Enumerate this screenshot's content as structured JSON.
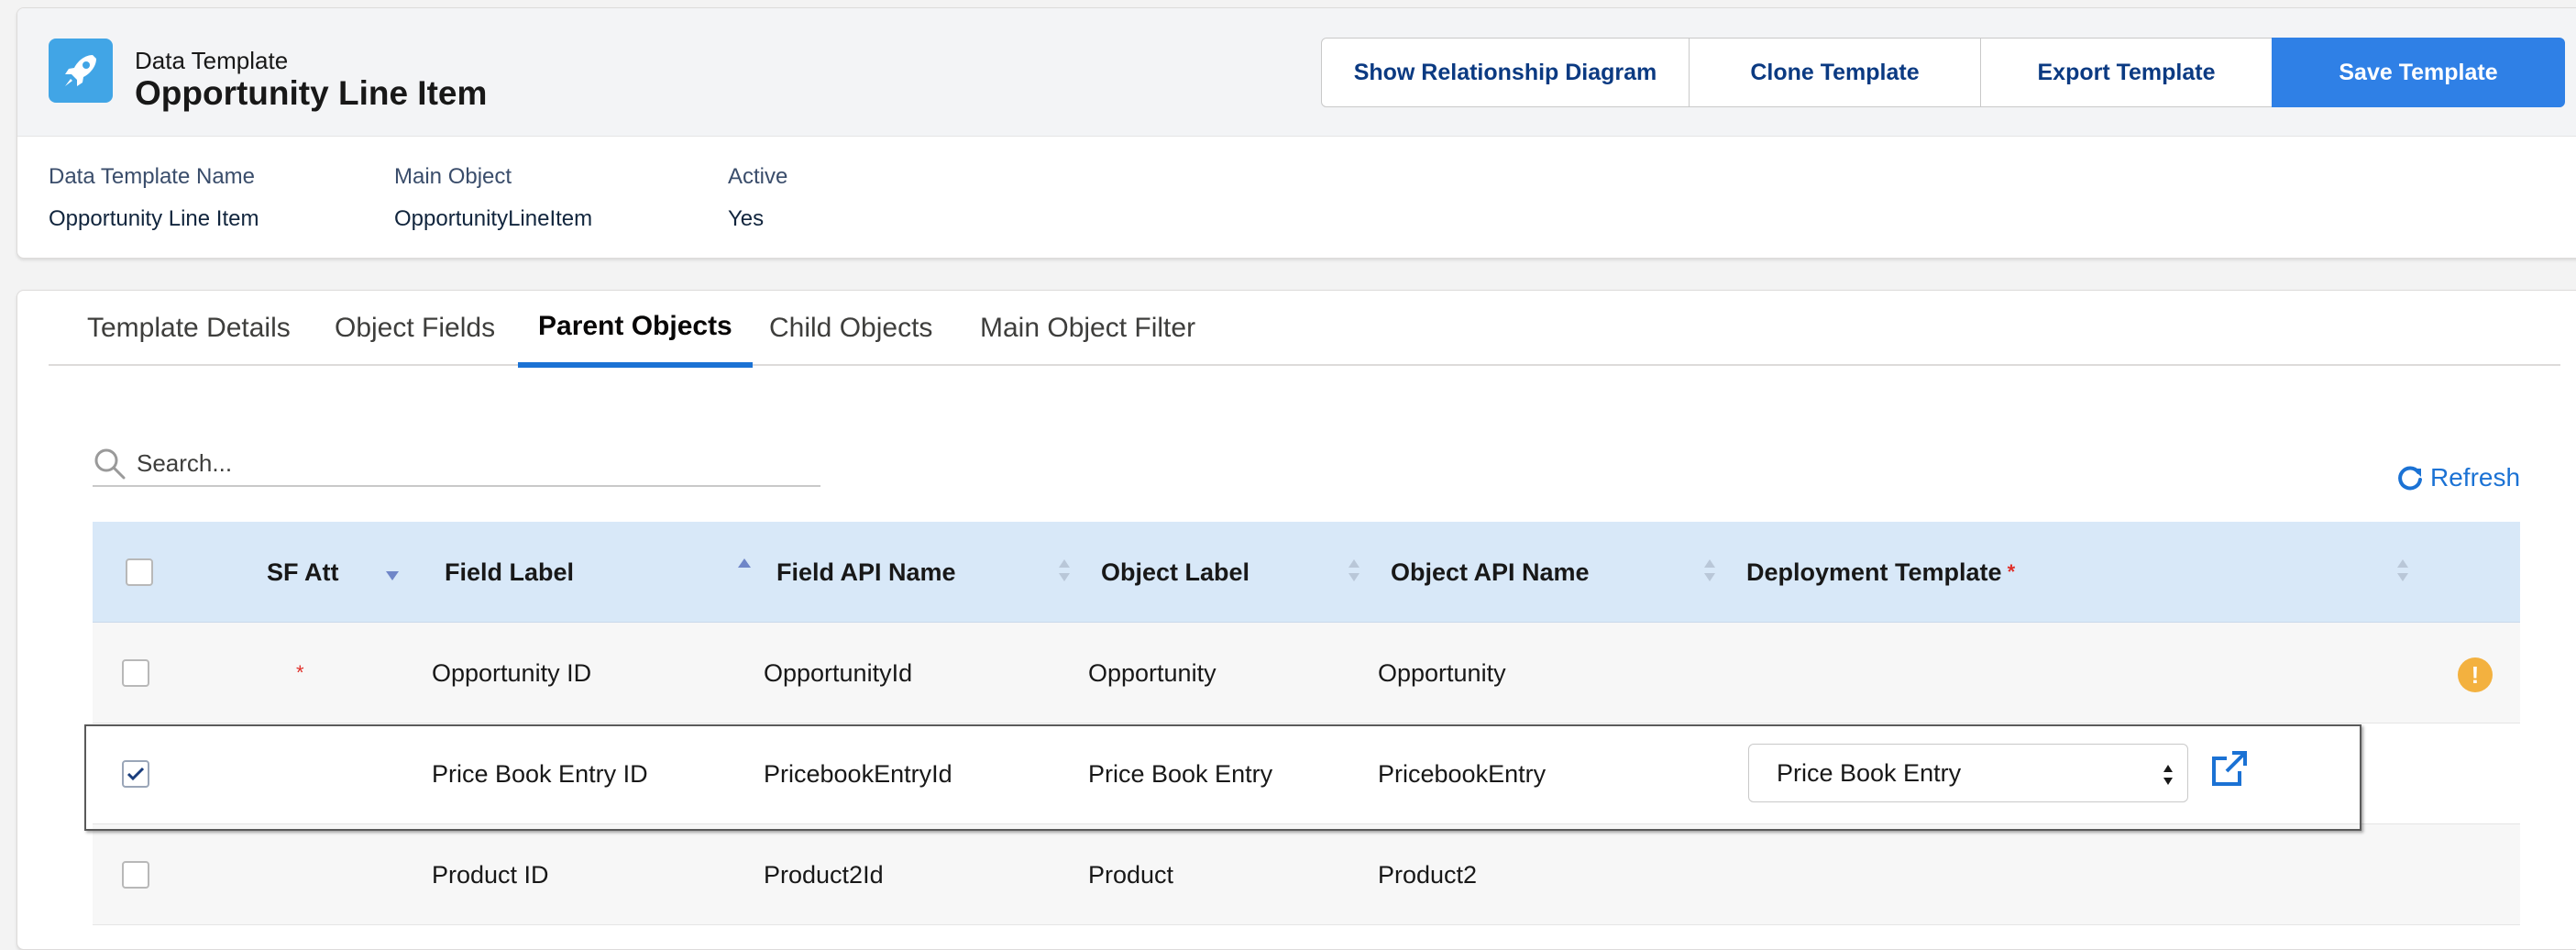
{
  "header": {
    "subtitle": "Data Template",
    "title": "Opportunity Line Item",
    "buttons": {
      "diagram": "Show Relationship Diagram",
      "clone": "Clone Template",
      "export": "Export Template",
      "save": "Save Template"
    },
    "meta": [
      {
        "label": "Data Template Name",
        "value": "Opportunity Line Item"
      },
      {
        "label": "Main Object",
        "value": "OpportunityLineItem"
      },
      {
        "label": "Active",
        "value": "Yes"
      }
    ]
  },
  "tabs": [
    {
      "label": "Template Details"
    },
    {
      "label": "Object Fields"
    },
    {
      "label": "Parent Objects",
      "active": true
    },
    {
      "label": "Child Objects"
    },
    {
      "label": "Main Object Filter"
    }
  ],
  "search": {
    "placeholder": "Search..."
  },
  "refresh_label": "Refresh",
  "table": {
    "columns": {
      "sf_att": "SF Att",
      "field_label": "Field Label",
      "field_api": "Field API Name",
      "object_label": "Object Label",
      "object_api": "Object API Name",
      "deployment": "Deployment Template"
    },
    "required_mark": "*",
    "rows": [
      {
        "checked": false,
        "sf_att": "*",
        "field_label": "Opportunity ID",
        "field_api": "OpportunityId",
        "object_label": "Opportunity",
        "object_api": "Opportunity",
        "deployment": "",
        "warning": "!"
      },
      {
        "checked": true,
        "sf_att": "",
        "field_label": "Price Book Entry ID",
        "field_api": "PricebookEntryId",
        "object_label": "Price Book Entry",
        "object_api": "PricebookEntry",
        "deployment": "Price Book Entry"
      },
      {
        "checked": false,
        "sf_att": "",
        "field_label": "Product ID",
        "field_api": "Product2Id",
        "object_label": "Product",
        "object_api": "Product2",
        "deployment": ""
      }
    ]
  },
  "colors": {
    "primary": "#2f80e6",
    "link": "#1b72d4",
    "header_row": "#d8e8f8",
    "warning": "#f3b13f",
    "required": "#e0302a"
  }
}
